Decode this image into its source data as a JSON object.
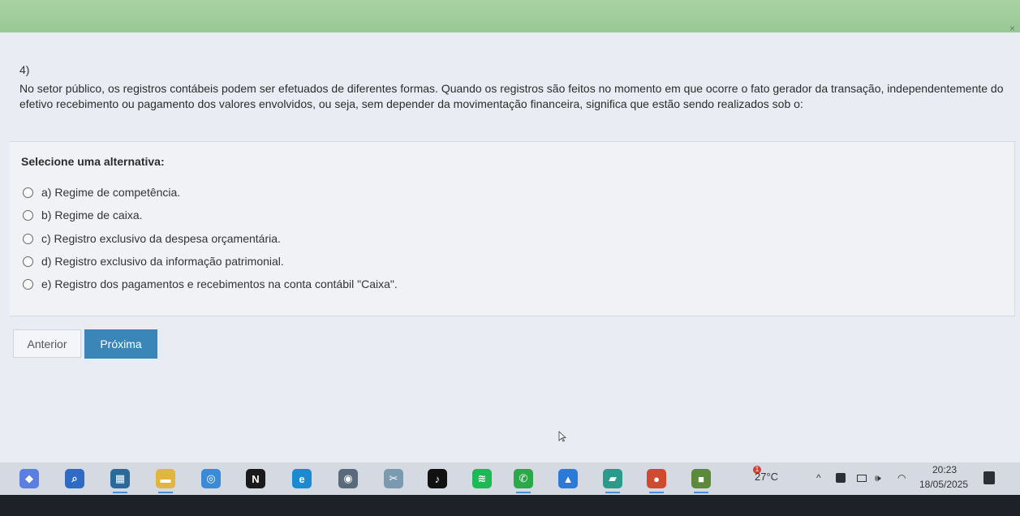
{
  "question": {
    "number": "4)",
    "text": "No setor público, os registros contábeis podem ser efetuados de diferentes formas. Quando os registros são feitos no momento em que ocorre o fato gerador da transação, independentemente do efetivo recebimento ou pagamento dos valores envolvidos, ou seja, sem depender da movimentação financeira, significa que estão sendo realizados sob o:"
  },
  "select_label": "Selecione uma alternativa:",
  "options": [
    {
      "label": "a) Regime de competência."
    },
    {
      "label": "b) Regime de caixa."
    },
    {
      "label": "c) Registro exclusivo da despesa orçamentária."
    },
    {
      "label": "d) Registro exclusivo da informação patrimonial."
    },
    {
      "label": "e) Registro dos pagamentos e recebimentos na conta contábil \"Caixa\"."
    }
  ],
  "buttons": {
    "previous": "Anterior",
    "next": "Próxima"
  },
  "window": {
    "close_glyph": "×"
  },
  "taskbar": {
    "apps": [
      {
        "name": "copilot-icon",
        "glyph": "◆",
        "color": "#5a7fe0"
      },
      {
        "name": "search-icon",
        "glyph": "⌕",
        "color": "#2d6bc4"
      },
      {
        "name": "calculator-icon",
        "glyph": "▦",
        "color": "#2a6a9a"
      },
      {
        "name": "file-explorer-icon",
        "glyph": "▬",
        "color": "#e0b640"
      },
      {
        "name": "magnifier-icon",
        "glyph": "◎",
        "color": "#3a8ad8"
      },
      {
        "name": "netflix-icon",
        "glyph": "N",
        "color": "#1a1a1a"
      },
      {
        "name": "edge-icon",
        "glyph": "e",
        "color": "#1c8ad0"
      },
      {
        "name": "camera-icon",
        "glyph": "◉",
        "color": "#5a6a7a"
      },
      {
        "name": "snipping-tool-icon",
        "glyph": "✂",
        "color": "#7a9ab0"
      },
      {
        "name": "tiktok-icon",
        "glyph": "♪",
        "color": "#111111"
      },
      {
        "name": "spotify-icon",
        "glyph": "≋",
        "color": "#1db954"
      },
      {
        "name": "whatsapp-icon",
        "glyph": "✆",
        "color": "#2aa84a"
      },
      {
        "name": "photos-icon",
        "glyph": "▲",
        "color": "#2a7ad8"
      },
      {
        "name": "gallery-icon",
        "glyph": "▰",
        "color": "#2a9a8a"
      },
      {
        "name": "chrome-icon",
        "glyph": "●",
        "color": "#d04a30"
      },
      {
        "name": "minecraft-icon",
        "glyph": "■",
        "color": "#5a8a3a"
      }
    ],
    "weather": {
      "temperature": "27°C",
      "badge": "1"
    },
    "tray": {
      "chevron": "^",
      "sound": "🕪",
      "wifi": "◠"
    },
    "clock": {
      "time": "20:23",
      "date": "18/05/2025"
    }
  },
  "colors": {
    "accent": "#3a86b9",
    "header_green": "#a9d2a3"
  }
}
